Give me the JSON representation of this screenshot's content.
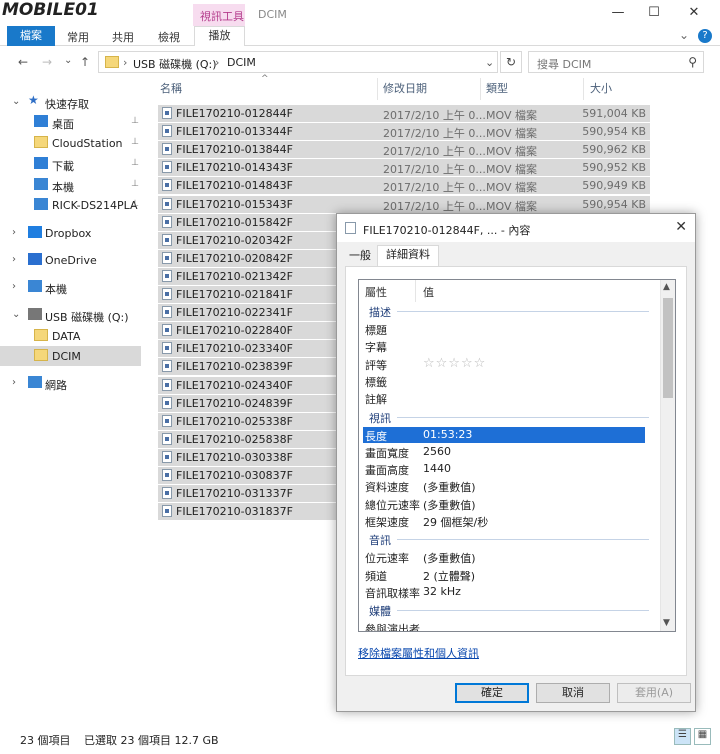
{
  "window": {
    "logo_text": "MOBILE01",
    "contextual_tab_title": "視訊工具",
    "title": "DCIM",
    "ctrl_min": "—",
    "ctrl_max": "☐",
    "ctrl_close": "✕"
  },
  "ribbon": {
    "tabs": [
      {
        "label": "檔案"
      },
      {
        "label": "常用"
      },
      {
        "label": "共用"
      },
      {
        "label": "檢視"
      },
      {
        "label": "播放"
      }
    ],
    "expand_icon": "⌄",
    "help_icon": "?"
  },
  "nav": {
    "back": "←",
    "forward": "→",
    "recent": "⌄",
    "up": "↑",
    "path": [
      "USB 磁碟機 (Q:)",
      "DCIM"
    ],
    "separator": "›",
    "path_dropdown": "⌄",
    "refresh": "↻",
    "search_placeholder": "搜尋 DCIM"
  },
  "sidebar": {
    "items": [
      {
        "label": "快速存取",
        "chev": "⌄",
        "icon": "star-icon",
        "pinned": false
      },
      {
        "label": "桌面",
        "chev": "",
        "icon": "desktop-icon",
        "pinned": true
      },
      {
        "label": "CloudStation",
        "chev": "",
        "icon": "folder-icon",
        "pinned": true
      },
      {
        "label": "下載",
        "chev": "",
        "icon": "download-icon",
        "pinned": true
      },
      {
        "label": "本機",
        "chev": "",
        "icon": "computer-icon",
        "pinned": true
      },
      {
        "label": "RICK-DS214PLA",
        "chev": "",
        "icon": "network-drive-icon",
        "pinned": true
      },
      {
        "label": "Dropbox",
        "chev": "›",
        "icon": "dropbox-icon",
        "pinned": false
      },
      {
        "label": "OneDrive",
        "chev": "›",
        "icon": "onedrive-icon",
        "pinned": false
      },
      {
        "label": "本機",
        "chev": "›",
        "icon": "computer-icon",
        "pinned": false
      },
      {
        "label": "USB 磁碟機 (Q:)",
        "chev": "⌄",
        "icon": "usb-drive-icon",
        "pinned": false
      },
      {
        "label": "DATA",
        "chev": "",
        "icon": "folder-icon",
        "pinned": false
      },
      {
        "label": "DCIM",
        "chev": "",
        "icon": "folder-icon",
        "pinned": false,
        "selected": true
      },
      {
        "label": "網路",
        "chev": "›",
        "icon": "network-icon",
        "pinned": false
      }
    ],
    "pin_glyph": "📌"
  },
  "columns": {
    "name": "名稱",
    "date": "修改日期",
    "type": "類型",
    "size": "大小",
    "sort_indicator": "^"
  },
  "files": [
    {
      "name": "FILE170210-012844F",
      "date": "2017/2/10 上午 0...",
      "type": "MOV 檔案",
      "size": "591,004 KB"
    },
    {
      "name": "FILE170210-013344F",
      "date": "2017/2/10 上午 0...",
      "type": "MOV 檔案",
      "size": "590,954 KB"
    },
    {
      "name": "FILE170210-013844F",
      "date": "2017/2/10 上午 0...",
      "type": "MOV 檔案",
      "size": "590,962 KB"
    },
    {
      "name": "FILE170210-014343F",
      "date": "2017/2/10 上午 0...",
      "type": "MOV 檔案",
      "size": "590,952 KB"
    },
    {
      "name": "FILE170210-014843F",
      "date": "2017/2/10 上午 0...",
      "type": "MOV 檔案",
      "size": "590,949 KB"
    },
    {
      "name": "FILE170210-015343F",
      "date": "2017/2/10 上午 0...",
      "type": "MOV 檔案",
      "size": "590,954 KB"
    },
    {
      "name": "FILE170210-015842F",
      "date": "",
      "type": "",
      "size": ""
    },
    {
      "name": "FILE170210-020342F",
      "date": "",
      "type": "",
      "size": ""
    },
    {
      "name": "FILE170210-020842F",
      "date": "",
      "type": "",
      "size": ""
    },
    {
      "name": "FILE170210-021342F",
      "date": "",
      "type": "",
      "size": ""
    },
    {
      "name": "FILE170210-021841F",
      "date": "",
      "type": "",
      "size": ""
    },
    {
      "name": "FILE170210-022341F",
      "date": "",
      "type": "",
      "size": ""
    },
    {
      "name": "FILE170210-022840F",
      "date": "",
      "type": "",
      "size": ""
    },
    {
      "name": "FILE170210-023340F",
      "date": "",
      "type": "",
      "size": ""
    },
    {
      "name": "FILE170210-023839F",
      "date": "",
      "type": "",
      "size": ""
    },
    {
      "name": "FILE170210-024340F",
      "date": "",
      "type": "",
      "size": ""
    },
    {
      "name": "FILE170210-024839F",
      "date": "",
      "type": "",
      "size": ""
    },
    {
      "name": "FILE170210-025338F",
      "date": "",
      "type": "",
      "size": ""
    },
    {
      "name": "FILE170210-025838F",
      "date": "",
      "type": "",
      "size": ""
    },
    {
      "name": "FILE170210-030338F",
      "date": "",
      "type": "",
      "size": ""
    },
    {
      "name": "FILE170210-030837F",
      "date": "",
      "type": "",
      "size": ""
    },
    {
      "name": "FILE170210-031337F",
      "date": "",
      "type": "",
      "size": ""
    },
    {
      "name": "FILE170210-031837F",
      "date": "",
      "type": "",
      "size": ""
    }
  ],
  "status": {
    "item_count": "23 個項目",
    "selected": "已選取 23 個項目  12.7 GB"
  },
  "dialog": {
    "title": "FILE170210-012844F, ... - 內容",
    "close": "✕",
    "tabs": [
      "一般",
      "詳細資料"
    ],
    "col_property": "屬性",
    "col_value": "值",
    "groups": [
      {
        "name": "描述",
        "props": [
          {
            "k": "標題",
            "v": ""
          },
          {
            "k": "字幕",
            "v": ""
          },
          {
            "k": "評等",
            "v": "",
            "stars": "☆☆☆☆☆"
          },
          {
            "k": "標籤",
            "v": ""
          },
          {
            "k": "註解",
            "v": ""
          }
        ]
      },
      {
        "name": "視訊",
        "props": [
          {
            "k": "長度",
            "v": "01:53:23",
            "selected": true
          },
          {
            "k": "畫面寬度",
            "v": "2560"
          },
          {
            "k": "畫面高度",
            "v": "1440"
          },
          {
            "k": "資料速度",
            "v": "(多重數值)"
          },
          {
            "k": "總位元速率",
            "v": "(多重數值)"
          },
          {
            "k": "框架速度",
            "v": "29 個框架/秒"
          }
        ]
      },
      {
        "name": "音訊",
        "props": [
          {
            "k": "位元速率",
            "v": "(多重數值)"
          },
          {
            "k": "頻道",
            "v": "2 (立體聲)"
          },
          {
            "k": "音訊取樣率",
            "v": "32 kHz"
          }
        ]
      },
      {
        "name": "媒體",
        "props": [
          {
            "k": "參與演出者",
            "v": ""
          }
        ]
      }
    ],
    "scroll_up": "▲",
    "scroll_down": "▼",
    "remove_link": "移除檔案屬性和個人資訊",
    "ok": "確定",
    "cancel": "取消",
    "apply": "套用(A)"
  }
}
